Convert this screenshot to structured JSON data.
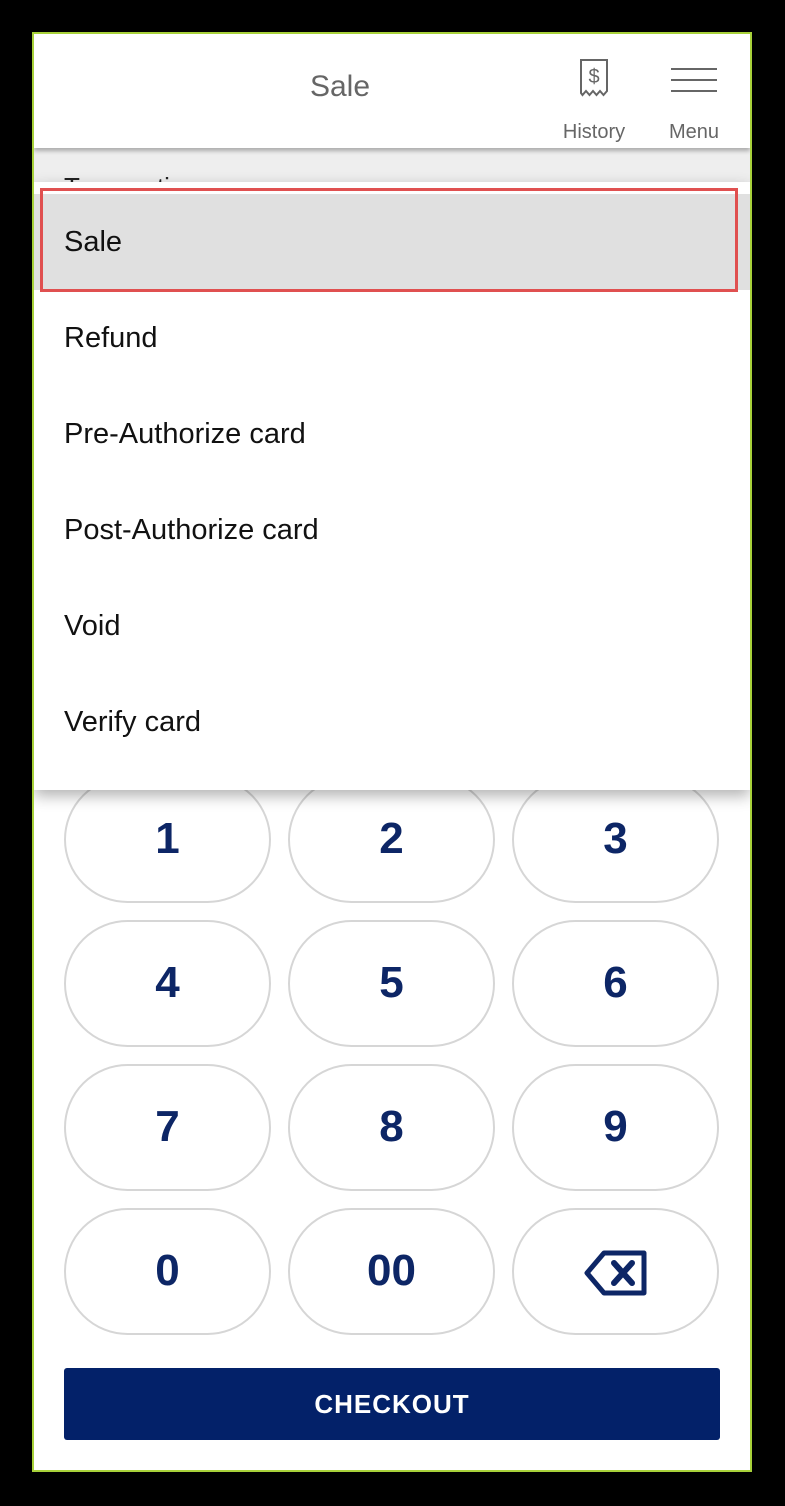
{
  "header": {
    "title": "Sale",
    "history_label": "History",
    "menu_label": "Menu"
  },
  "underlying": {
    "field_label": "Transaction"
  },
  "dropdown": {
    "selected": "Sale",
    "items": [
      {
        "label": "Sale"
      },
      {
        "label": "Refund"
      },
      {
        "label": "Pre-Authorize card"
      },
      {
        "label": "Post-Authorize card"
      },
      {
        "label": "Void"
      },
      {
        "label": "Verify card"
      }
    ]
  },
  "keypad": {
    "keys": [
      "1",
      "2",
      "3",
      "4",
      "5",
      "6",
      "7",
      "8",
      "9",
      "0",
      "00"
    ],
    "backspace_icon": "backspace-icon"
  },
  "checkout_label": "CHECKOUT",
  "colors": {
    "accent": "#032169",
    "key_text": "#0d2666",
    "frame_border": "#a8d13a",
    "highlight": "#e05050"
  }
}
